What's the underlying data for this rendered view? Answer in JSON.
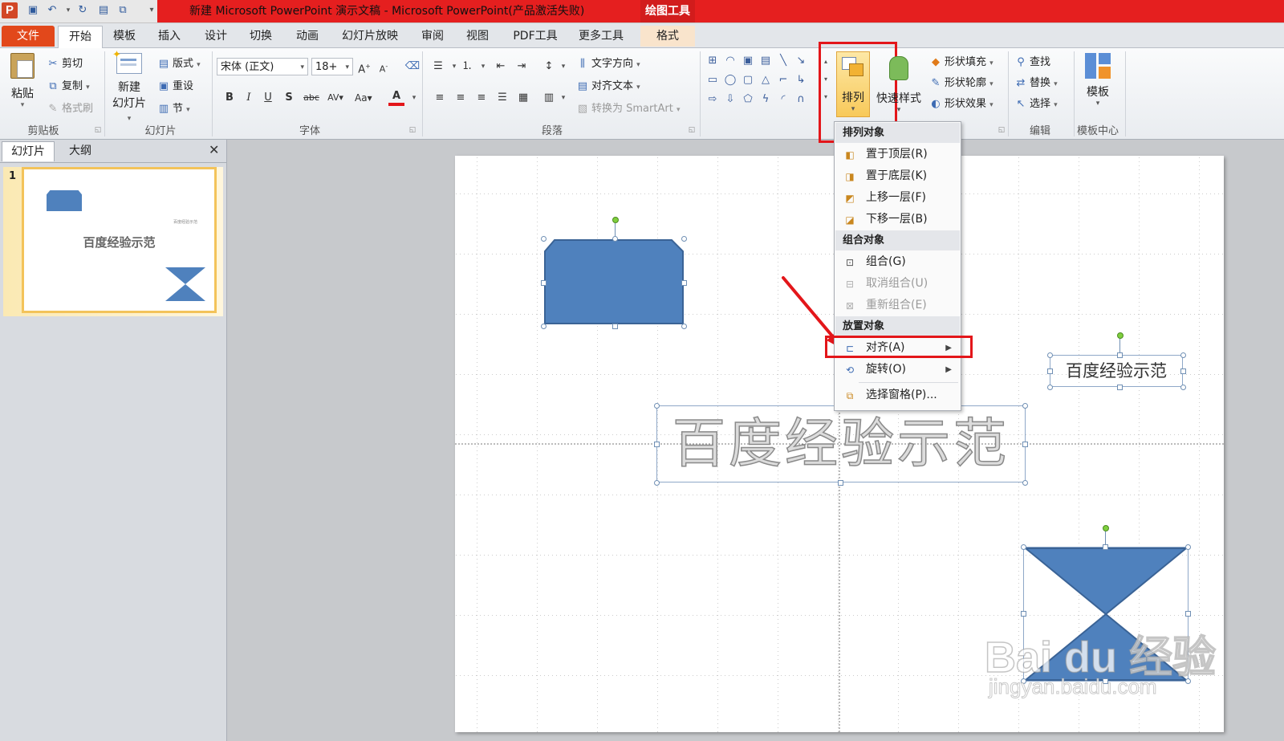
{
  "titlebar": {
    "title": "新建 Microsoft PowerPoint 演示文稿 - Microsoft PowerPoint(产品激活失败)",
    "context_tab": "绘图工具"
  },
  "tabs": [
    "文件",
    "开始",
    "模板",
    "插入",
    "设计",
    "切换",
    "动画",
    "幻灯片放映",
    "审阅",
    "视图",
    "PDF工具",
    "更多工具",
    "格式"
  ],
  "ribbon": {
    "clipboard": {
      "paste": "粘贴",
      "cut": "剪切",
      "copy": "复制",
      "format_painter": "格式刷",
      "label": "剪贴板"
    },
    "slides": {
      "new_slide_1": "新建",
      "new_slide_2": "幻灯片",
      "layout": "版式",
      "reset": "重设",
      "section": "节",
      "label": "幻灯片"
    },
    "font": {
      "name": "宋体 (正文)",
      "size": "18+",
      "label": "字体"
    },
    "paragraph": {
      "text_direction": "文字方向",
      "align_text": "对齐文本",
      "smartart": "转换为 SmartArt",
      "label": "段落"
    },
    "drawing": {
      "arrange": "排列",
      "quick_styles": "快速样式",
      "shape_fill": "形状填充",
      "shape_outline": "形状轮廓",
      "shape_effects": "形状效果"
    },
    "editing": {
      "find": "查找",
      "replace": "替换",
      "select": "选择",
      "label": "编辑"
    },
    "template": {
      "button": "模板",
      "label": "模板中心"
    }
  },
  "left_pane": {
    "tabs": [
      "幻灯片",
      "大纲"
    ],
    "slide_number": "1",
    "thumb_title": "百度经验示范",
    "thumb_small": "百度经验示范"
  },
  "slide": {
    "big_text": "百度经验示范",
    "small_text": "百度经验示范"
  },
  "watermark": {
    "brand": "Bai du 经验",
    "url": "jingyan.baidu.com"
  },
  "arrange_menu": {
    "section_order": "排列对象",
    "bring_to_front": "置于顶层(R)",
    "send_to_back": "置于底层(K)",
    "bring_forward": "上移一层(F)",
    "send_backward": "下移一层(B)",
    "section_group": "组合对象",
    "group": "组合(G)",
    "ungroup": "取消组合(U)",
    "regroup": "重新组合(E)",
    "section_position": "放置对象",
    "align": "对齐(A)",
    "rotate": "旋转(O)",
    "selection_pane": "选择窗格(P)..."
  },
  "colors": {
    "title_red": "#e51f1f",
    "file_tab": "#e2481b",
    "shape_blue": "#4f81bd",
    "highlight_red": "#e3161a"
  }
}
